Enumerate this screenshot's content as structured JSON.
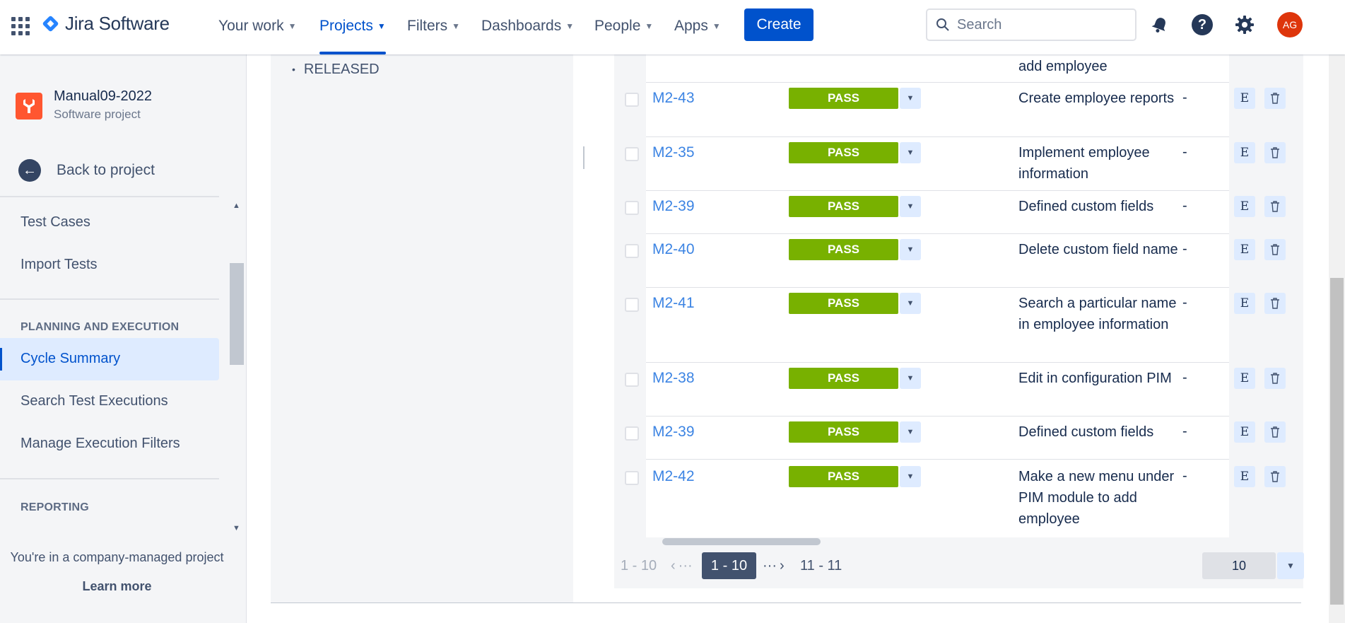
{
  "topnav": {
    "brand": "Jira Software",
    "items": [
      {
        "label": "Your work"
      },
      {
        "label": "Projects"
      },
      {
        "label": "Filters"
      },
      {
        "label": "Dashboards"
      },
      {
        "label": "People"
      },
      {
        "label": "Apps"
      }
    ],
    "active_item": "Projects",
    "create_label": "Create",
    "search_placeholder": "Search",
    "avatar_initials": "AG",
    "accent_color": "#0052cc",
    "avatar_color": "#de350b"
  },
  "sidebar": {
    "project_name": "Manual09-2022",
    "project_type": "Software project",
    "back_label": "Back to project",
    "items": [
      {
        "label": "Test Cases"
      },
      {
        "label": "Import Tests"
      }
    ],
    "section_planning": "PLANNING AND EXECUTION",
    "planning_items": [
      {
        "label": "Cycle Summary"
      },
      {
        "label": "Search Test Executions"
      },
      {
        "label": "Manage Execution Filters"
      }
    ],
    "active_item": "Cycle Summary",
    "section_reporting": "REPORTING",
    "company_note": "You're in a company-managed project",
    "learn_more": "Learn more"
  },
  "versions": {
    "released_label": "RELEASED"
  },
  "executions": {
    "partial_top_summary": "add employee",
    "status_color": "#78b100",
    "rows": [
      {
        "key": "M2-43",
        "status": "PASS",
        "summary": "Create employee reports",
        "defects": "-"
      },
      {
        "key": "M2-35",
        "status": "PASS",
        "summary": "Implement employee information",
        "defects": "-"
      },
      {
        "key": "M2-39",
        "status": "PASS",
        "summary": "Defined custom fields",
        "defects": "-"
      },
      {
        "key": "M2-40",
        "status": "PASS",
        "summary": "Delete custom field name",
        "defects": "-"
      },
      {
        "key": "M2-41",
        "status": "PASS",
        "summary": "Search a particular name in employee information",
        "defects": "-"
      },
      {
        "key": "M2-38",
        "status": "PASS",
        "summary": "Edit in configuration PIM",
        "defects": "-"
      },
      {
        "key": "M2-39",
        "status": "PASS",
        "summary": "Defined custom fields",
        "defects": "-"
      },
      {
        "key": "M2-42",
        "status": "PASS",
        "summary": "Make a new menu under PIM module to add employee",
        "defects": "-"
      }
    ],
    "edit_action": "E"
  },
  "pagination": {
    "range_label": "1 - 10",
    "ellipsis": "···",
    "current_page": "1 - 10",
    "next_page": "11 - 11",
    "page_size": "10"
  }
}
